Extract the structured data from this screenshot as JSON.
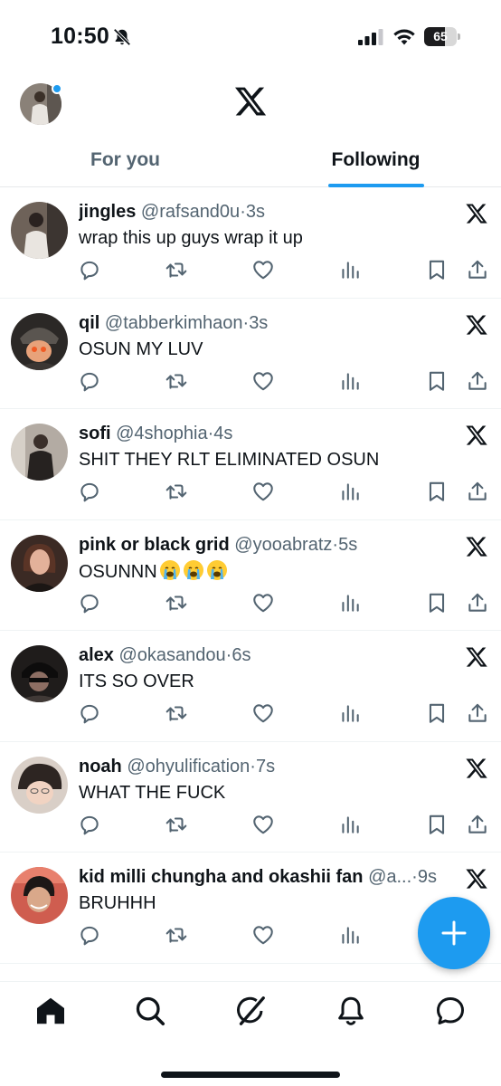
{
  "status_bar": {
    "time": "10:50",
    "battery_label": "65",
    "battery_level": 0.65,
    "icons": [
      "bell-slash-icon",
      "cellular-signal-icon",
      "wifi-icon",
      "battery-icon"
    ]
  },
  "header": {
    "logo": "x-logo-icon",
    "tabs": [
      {
        "label": "For you",
        "active": false
      },
      {
        "label": "Following",
        "active": true
      }
    ]
  },
  "tweets": [
    {
      "name": "jingles",
      "handle": "@rafsand0u",
      "time": "3s",
      "text": "wrap this up guys wrap it up",
      "emoji_count": 0
    },
    {
      "name": "qil",
      "handle": "@tabberkimhaon",
      "time": "3s",
      "text": "OSUN MY LUV",
      "emoji_count": 0
    },
    {
      "name": "sofi",
      "handle": "@4shophia",
      "time": "4s",
      "text": "SHIT THEY RLT ELIMINATED OSUN",
      "emoji_count": 0
    },
    {
      "name": "pink or black grid",
      "handle": "@yooabratz",
      "time": "5s",
      "text": "OSUNNN",
      "emoji_count": 3
    },
    {
      "name": "alex",
      "handle": "@okasandou",
      "time": "6s",
      "text": "ITS SO OVER",
      "emoji_count": 0
    },
    {
      "name": "noah",
      "handle": "@ohyulification",
      "time": "7s",
      "text": "WHAT THE FUCK",
      "emoji_count": 0
    },
    {
      "name": "kid milli chungha and okashii fan",
      "handle": "@a...",
      "time": "9s",
      "text": "BRUHHH",
      "emoji_count": 0
    }
  ],
  "tweet_action_icons": [
    "reply-icon",
    "retweet-icon",
    "like-icon",
    "views-icon",
    "bookmark-icon",
    "share-icon"
  ],
  "fab": {
    "icon": "plus-icon"
  },
  "bottom_nav": [
    "home-icon",
    "search-icon",
    "grok-icon",
    "notifications-icon",
    "messages-icon"
  ],
  "colors": {
    "accent": "#1d9bf0",
    "text": "#0f1419",
    "muted": "#536471",
    "divider": "#eff3f4"
  }
}
